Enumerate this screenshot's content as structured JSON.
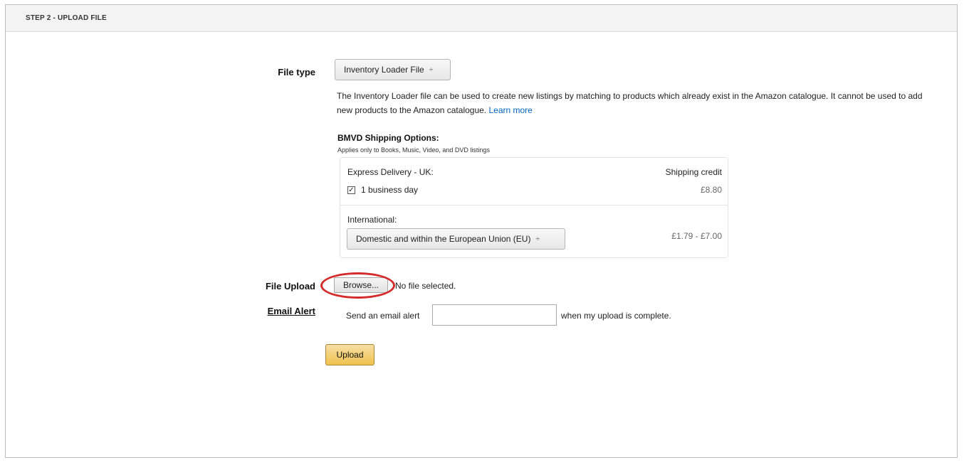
{
  "step_header": "STEP 2 - UPLOAD FILE",
  "file_type": {
    "label": "File type",
    "selected": "Inventory Loader File",
    "chevron": "⌃⌄"
  },
  "description": {
    "text": "The Inventory Loader file can be used to create new listings by matching to products which already exist in the Amazon catalogue. It cannot be used to add new products to the Amazon catalogue.",
    "link": "Learn more"
  },
  "bmvd": {
    "title": "BMVD Shipping Options:",
    "subtitle": "Applies only to Books, Music, Video, and DVD listings",
    "express_label": "Express Delivery - UK:",
    "shipping_credit_header": "Shipping credit",
    "business_day_label": "1 business day",
    "business_day_checked": true,
    "business_day_price": "£8.80",
    "international_label": "International:",
    "international_selected": "Domestic and within the European Union (EU)",
    "international_price": "£1.79 - £7.00"
  },
  "file_upload": {
    "label": "File Upload",
    "browse_label": "Browse...",
    "status": "No file selected."
  },
  "email_alert": {
    "label": "Email Alert",
    "prefix": "Send an email alert",
    "value": "",
    "suffix": "when my upload is complete."
  },
  "upload_button": "Upload",
  "colors": {
    "highlight_ellipse": "#d42b2b",
    "upload_button": "#f0c14b",
    "link": "#0066c0"
  }
}
